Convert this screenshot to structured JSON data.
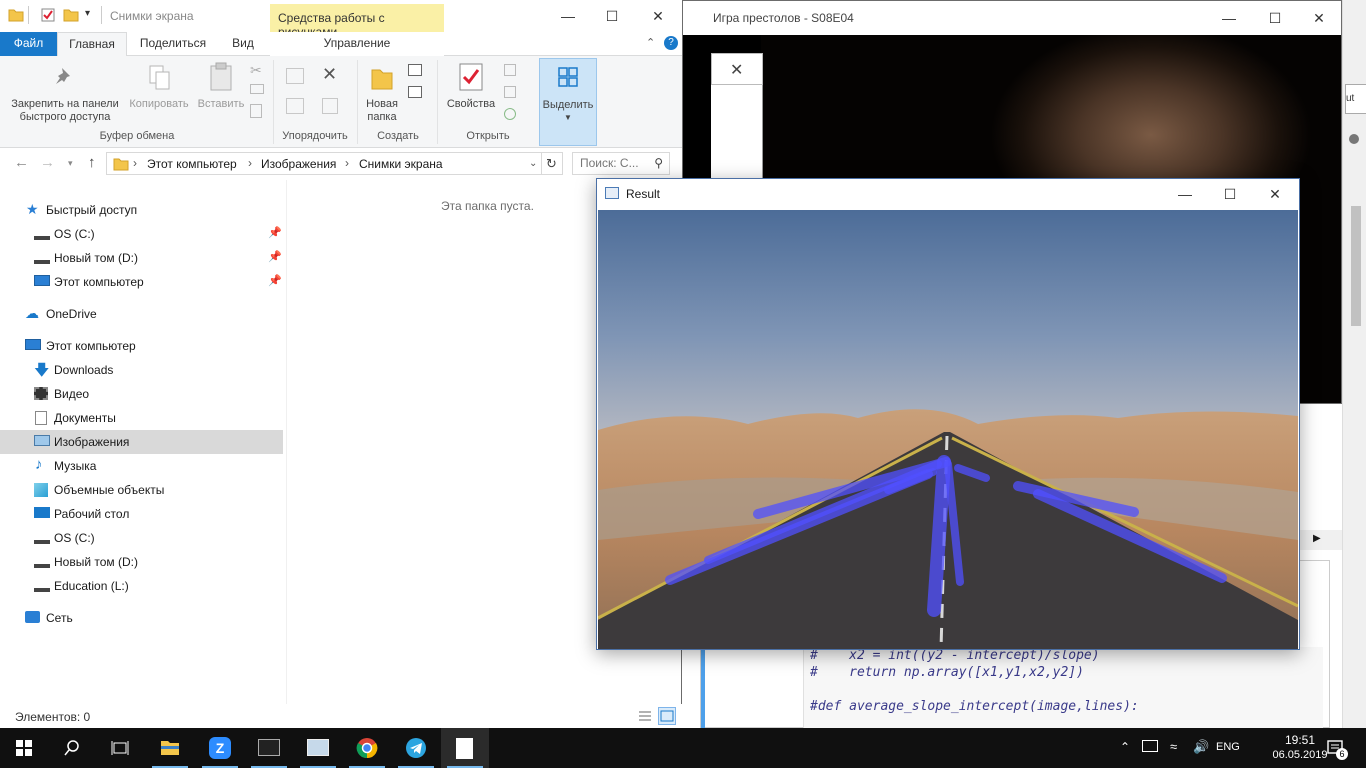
{
  "video_window": {
    "title": "Игра престолов - S08E04",
    "close_label": "✕"
  },
  "explorer": {
    "title": "Снимки экрана",
    "contextual_tab": "Средства работы с рисунками",
    "tabs": [
      "Файл",
      "Главная",
      "Поделиться",
      "Вид",
      "Управление"
    ],
    "ribbon": {
      "pin_label": "Закрепить на панели быстрого доступа",
      "copy_label": "Копировать",
      "paste_label": "Вставить",
      "new_folder_label": "Новая папка",
      "properties_label": "Свойства",
      "select_label": "Выделить",
      "groups": {
        "clipboard": "Буфер обмена",
        "organize": "Упорядочить",
        "create": "Создать",
        "open": "Открыть"
      }
    },
    "address": {
      "crumbs": [
        "Этот компьютер",
        "Изображения",
        "Снимки экрана"
      ],
      "search_placeholder": "Поиск: С..."
    },
    "nav": {
      "quick_access": "Быстрый доступ",
      "os_c": "OS (C:)",
      "new_vol_d": "Новый том (D:)",
      "this_pc_pinned": "Этот компьютер",
      "onedrive": "OneDrive",
      "this_pc": "Этот компьютер",
      "downloads": "Downloads",
      "video": "Видео",
      "documents": "Документы",
      "pictures": "Изображения",
      "music": "Музыка",
      "objects3d": "Объемные объекты",
      "desktop": "Рабочий стол",
      "os_c2": "OS (C:)",
      "new_vol_d2": "Новый том (D:)",
      "education": "Education (L:)",
      "network": "Сеть"
    },
    "empty_message": "Эта папка пуста.",
    "status": "Элементов: 0"
  },
  "result_window": {
    "title": "Result"
  },
  "editor": {
    "code_lines": [
      "#    x2 = int((y2 - intercept)/slope)",
      "#    return np.array([x1,y1,x2,y2])",
      "",
      "#def average_slope_intercept(image,lines):"
    ],
    "side_button": "ut"
  },
  "taskbar": {
    "lang": "ENG",
    "time": "19:51",
    "date": "06.05.2019",
    "notification_count": "6"
  },
  "colors": {
    "accent": "#1979ca",
    "lane_lines": "#5050ff",
    "context_tab": "#faf0a6"
  }
}
